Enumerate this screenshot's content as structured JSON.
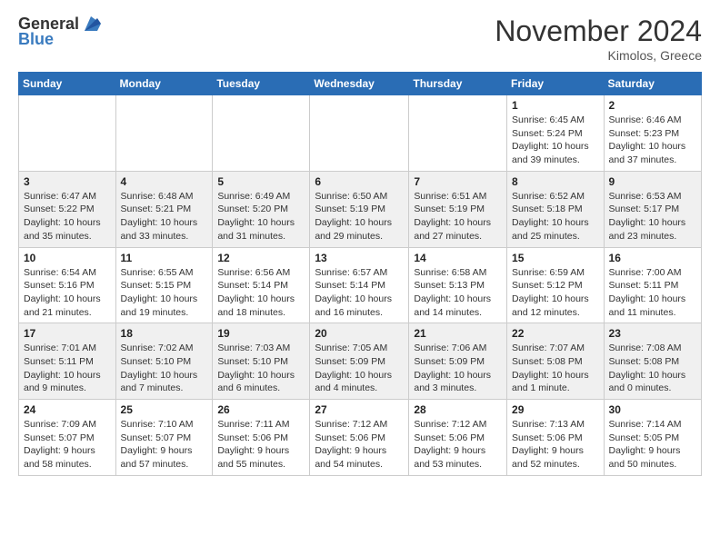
{
  "header": {
    "logo_general": "General",
    "logo_blue": "Blue",
    "month": "November 2024",
    "location": "Kimolos, Greece"
  },
  "weekdays": [
    "Sunday",
    "Monday",
    "Tuesday",
    "Wednesday",
    "Thursday",
    "Friday",
    "Saturday"
  ],
  "weeks": [
    [
      {
        "day": "",
        "info": ""
      },
      {
        "day": "",
        "info": ""
      },
      {
        "day": "",
        "info": ""
      },
      {
        "day": "",
        "info": ""
      },
      {
        "day": "",
        "info": ""
      },
      {
        "day": "1",
        "info": "Sunrise: 6:45 AM\nSunset: 5:24 PM\nDaylight: 10 hours and 39 minutes."
      },
      {
        "day": "2",
        "info": "Sunrise: 6:46 AM\nSunset: 5:23 PM\nDaylight: 10 hours and 37 minutes."
      }
    ],
    [
      {
        "day": "3",
        "info": "Sunrise: 6:47 AM\nSunset: 5:22 PM\nDaylight: 10 hours and 35 minutes."
      },
      {
        "day": "4",
        "info": "Sunrise: 6:48 AM\nSunset: 5:21 PM\nDaylight: 10 hours and 33 minutes."
      },
      {
        "day": "5",
        "info": "Sunrise: 6:49 AM\nSunset: 5:20 PM\nDaylight: 10 hours and 31 minutes."
      },
      {
        "day": "6",
        "info": "Sunrise: 6:50 AM\nSunset: 5:19 PM\nDaylight: 10 hours and 29 minutes."
      },
      {
        "day": "7",
        "info": "Sunrise: 6:51 AM\nSunset: 5:19 PM\nDaylight: 10 hours and 27 minutes."
      },
      {
        "day": "8",
        "info": "Sunrise: 6:52 AM\nSunset: 5:18 PM\nDaylight: 10 hours and 25 minutes."
      },
      {
        "day": "9",
        "info": "Sunrise: 6:53 AM\nSunset: 5:17 PM\nDaylight: 10 hours and 23 minutes."
      }
    ],
    [
      {
        "day": "10",
        "info": "Sunrise: 6:54 AM\nSunset: 5:16 PM\nDaylight: 10 hours and 21 minutes."
      },
      {
        "day": "11",
        "info": "Sunrise: 6:55 AM\nSunset: 5:15 PM\nDaylight: 10 hours and 19 minutes."
      },
      {
        "day": "12",
        "info": "Sunrise: 6:56 AM\nSunset: 5:14 PM\nDaylight: 10 hours and 18 minutes."
      },
      {
        "day": "13",
        "info": "Sunrise: 6:57 AM\nSunset: 5:14 PM\nDaylight: 10 hours and 16 minutes."
      },
      {
        "day": "14",
        "info": "Sunrise: 6:58 AM\nSunset: 5:13 PM\nDaylight: 10 hours and 14 minutes."
      },
      {
        "day": "15",
        "info": "Sunrise: 6:59 AM\nSunset: 5:12 PM\nDaylight: 10 hours and 12 minutes."
      },
      {
        "day": "16",
        "info": "Sunrise: 7:00 AM\nSunset: 5:11 PM\nDaylight: 10 hours and 11 minutes."
      }
    ],
    [
      {
        "day": "17",
        "info": "Sunrise: 7:01 AM\nSunset: 5:11 PM\nDaylight: 10 hours and 9 minutes."
      },
      {
        "day": "18",
        "info": "Sunrise: 7:02 AM\nSunset: 5:10 PM\nDaylight: 10 hours and 7 minutes."
      },
      {
        "day": "19",
        "info": "Sunrise: 7:03 AM\nSunset: 5:10 PM\nDaylight: 10 hours and 6 minutes."
      },
      {
        "day": "20",
        "info": "Sunrise: 7:05 AM\nSunset: 5:09 PM\nDaylight: 10 hours and 4 minutes."
      },
      {
        "day": "21",
        "info": "Sunrise: 7:06 AM\nSunset: 5:09 PM\nDaylight: 10 hours and 3 minutes."
      },
      {
        "day": "22",
        "info": "Sunrise: 7:07 AM\nSunset: 5:08 PM\nDaylight: 10 hours and 1 minute."
      },
      {
        "day": "23",
        "info": "Sunrise: 7:08 AM\nSunset: 5:08 PM\nDaylight: 10 hours and 0 minutes."
      }
    ],
    [
      {
        "day": "24",
        "info": "Sunrise: 7:09 AM\nSunset: 5:07 PM\nDaylight: 9 hours and 58 minutes."
      },
      {
        "day": "25",
        "info": "Sunrise: 7:10 AM\nSunset: 5:07 PM\nDaylight: 9 hours and 57 minutes."
      },
      {
        "day": "26",
        "info": "Sunrise: 7:11 AM\nSunset: 5:06 PM\nDaylight: 9 hours and 55 minutes."
      },
      {
        "day": "27",
        "info": "Sunrise: 7:12 AM\nSunset: 5:06 PM\nDaylight: 9 hours and 54 minutes."
      },
      {
        "day": "28",
        "info": "Sunrise: 7:12 AM\nSunset: 5:06 PM\nDaylight: 9 hours and 53 minutes."
      },
      {
        "day": "29",
        "info": "Sunrise: 7:13 AM\nSunset: 5:06 PM\nDaylight: 9 hours and 52 minutes."
      },
      {
        "day": "30",
        "info": "Sunrise: 7:14 AM\nSunset: 5:05 PM\nDaylight: 9 hours and 50 minutes."
      }
    ]
  ]
}
